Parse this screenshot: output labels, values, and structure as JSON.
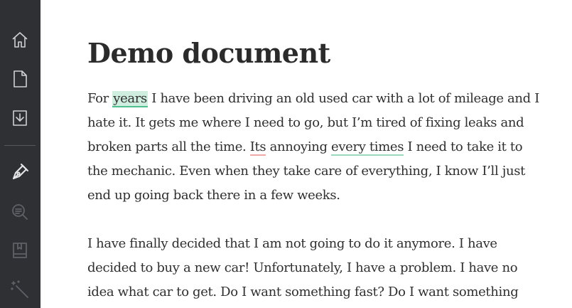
{
  "sidebar": {
    "icons": [
      "home-icon",
      "document-icon",
      "download-icon",
      "pen-icon",
      "search-icon",
      "book-icon",
      "magic-wand-icon"
    ]
  },
  "document": {
    "title": "Demo document",
    "paragraph1": {
      "line1": {
        "pre": "For ",
        "highlight": "years",
        "post": " I have been driving an old used car with a lot of mileage and I"
      },
      "line2": "hate it. It gets me where I need to go, but I’m tired of fixing leaks and",
      "line3": {
        "pre": "broken parts all the time. ",
        "error": "Its",
        "mid": " annoying ",
        "suggestion": "every times",
        "post": " I need to take it to"
      },
      "line4": "the mechanic. Even when they take care of everything, I know I’ll just",
      "line5": "end up going back there in a few weeks."
    },
    "paragraph2": {
      "line1": "I have finally decided that I am not going to do it anymore. I have",
      "line2": "decided to buy a new car! Unfortunately, I have a problem. I have no",
      "line3": "idea what car to get. Do I want something fast? Do I want something"
    }
  },
  "colors": {
    "sidebar_bg": "#2f3034",
    "highlight_green": "#cfeee0",
    "error_underline": "#f2a7a7",
    "suggestion_underline": "#9bd9bd"
  }
}
